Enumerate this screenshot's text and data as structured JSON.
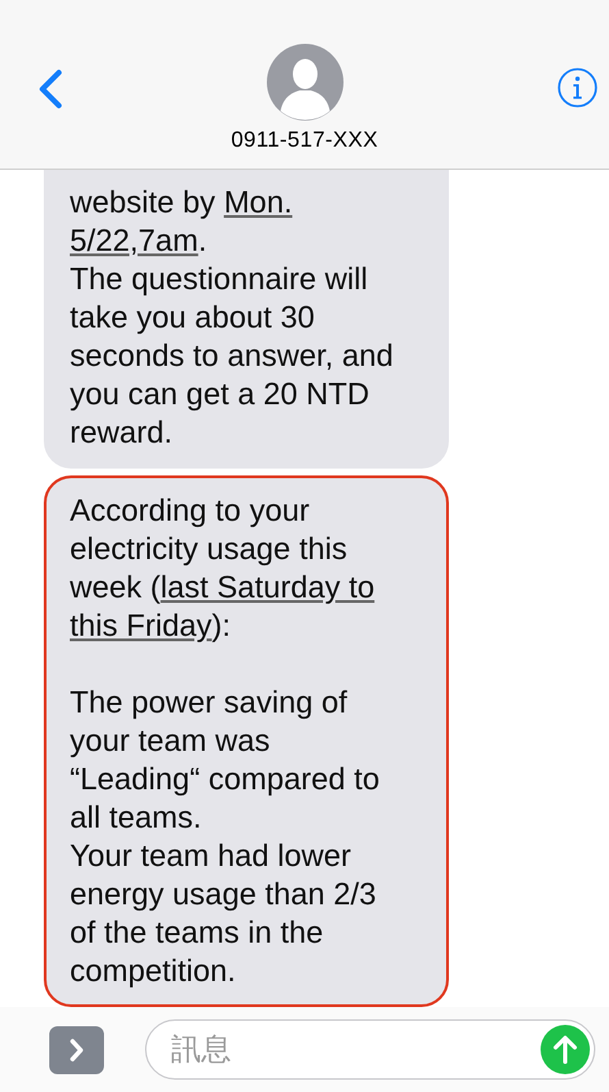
{
  "header": {
    "contact": "0911-517-XXX"
  },
  "messages": [
    {
      "highlighted": false,
      "cut_top": true,
      "paragraphs": [
        {
          "space_before": false,
          "segments": [
            {
              "text": "website by ",
              "underlined": false
            },
            {
              "text": "Mon. 5/22,7am",
              "underlined": true
            },
            {
              "text": ".",
              "underlined": false
            }
          ]
        },
        {
          "space_before": false,
          "segments": [
            {
              "text": "The questionnaire will take you about 30 seconds to answer, and you can get a 20 NTD reward.",
              "underlined": false
            }
          ]
        }
      ]
    },
    {
      "highlighted": true,
      "cut_top": false,
      "paragraphs": [
        {
          "space_before": false,
          "segments": [
            {
              "text": "According to your electricity usage this week (",
              "underlined": false
            },
            {
              "text": "last Saturday to this Friday",
              "underlined": true
            },
            {
              "text": "):",
              "underlined": false
            }
          ]
        },
        {
          "space_before": true,
          "segments": [
            {
              "text": "The power saving of your team was “Leading“ compared to all teams.",
              "underlined": false
            }
          ]
        },
        {
          "space_before": false,
          "segments": [
            {
              "text": "Your team had lower energy usage than 2/3 of the teams in the competition.",
              "underlined": false
            }
          ]
        }
      ]
    }
  ],
  "composer": {
    "placeholder": "訊息"
  }
}
